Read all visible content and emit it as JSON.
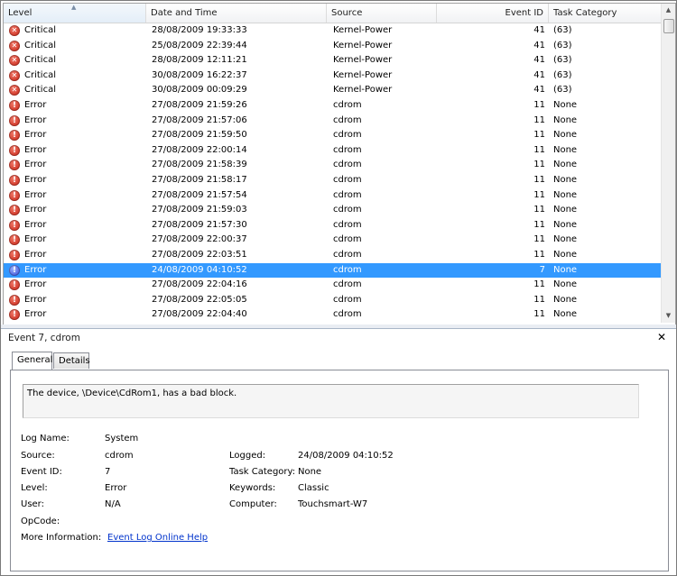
{
  "grid": {
    "columns": {
      "level": "Level",
      "date": "Date and Time",
      "source": "Source",
      "event_id": "Event ID",
      "category": "Task Category"
    },
    "rows": [
      {
        "level": "Critical",
        "icon": "critical-icon",
        "date": "28/08/2009 19:33:33",
        "source": "Kernel-Power",
        "id": "41",
        "category": "(63)"
      },
      {
        "level": "Critical",
        "icon": "critical-icon",
        "date": "25/08/2009 22:39:44",
        "source": "Kernel-Power",
        "id": "41",
        "category": "(63)"
      },
      {
        "level": "Critical",
        "icon": "critical-icon",
        "date": "28/08/2009 12:11:21",
        "source": "Kernel-Power",
        "id": "41",
        "category": "(63)"
      },
      {
        "level": "Critical",
        "icon": "critical-icon",
        "date": "30/08/2009 16:22:37",
        "source": "Kernel-Power",
        "id": "41",
        "category": "(63)"
      },
      {
        "level": "Critical",
        "icon": "critical-icon",
        "date": "30/08/2009 00:09:29",
        "source": "Kernel-Power",
        "id": "41",
        "category": "(63)"
      },
      {
        "level": "Error",
        "icon": "error-icon",
        "date": "27/08/2009 21:59:26",
        "source": "cdrom",
        "id": "11",
        "category": "None"
      },
      {
        "level": "Error",
        "icon": "error-icon",
        "date": "27/08/2009 21:57:06",
        "source": "cdrom",
        "id": "11",
        "category": "None"
      },
      {
        "level": "Error",
        "icon": "error-icon",
        "date": "27/08/2009 21:59:50",
        "source": "cdrom",
        "id": "11",
        "category": "None"
      },
      {
        "level": "Error",
        "icon": "error-icon",
        "date": "27/08/2009 22:00:14",
        "source": "cdrom",
        "id": "11",
        "category": "None"
      },
      {
        "level": "Error",
        "icon": "error-icon",
        "date": "27/08/2009 21:58:39",
        "source": "cdrom",
        "id": "11",
        "category": "None"
      },
      {
        "level": "Error",
        "icon": "error-icon",
        "date": "27/08/2009 21:58:17",
        "source": "cdrom",
        "id": "11",
        "category": "None"
      },
      {
        "level": "Error",
        "icon": "error-icon",
        "date": "27/08/2009 21:57:54",
        "source": "cdrom",
        "id": "11",
        "category": "None"
      },
      {
        "level": "Error",
        "icon": "error-icon",
        "date": "27/08/2009 21:59:03",
        "source": "cdrom",
        "id": "11",
        "category": "None"
      },
      {
        "level": "Error",
        "icon": "error-icon",
        "date": "27/08/2009 21:57:30",
        "source": "cdrom",
        "id": "11",
        "category": "None"
      },
      {
        "level": "Error",
        "icon": "error-icon",
        "date": "27/08/2009 22:00:37",
        "source": "cdrom",
        "id": "11",
        "category": "None"
      },
      {
        "level": "Error",
        "icon": "error-icon",
        "date": "27/08/2009 22:03:51",
        "source": "cdrom",
        "id": "11",
        "category": "None"
      },
      {
        "level": "Error",
        "icon": "error-icon",
        "date": "24/08/2009 04:10:52",
        "source": "cdrom",
        "id": "7",
        "category": "None",
        "selected": true
      },
      {
        "level": "Error",
        "icon": "error-icon",
        "date": "27/08/2009 22:04:16",
        "source": "cdrom",
        "id": "11",
        "category": "None"
      },
      {
        "level": "Error",
        "icon": "error-icon",
        "date": "27/08/2009 22:05:05",
        "source": "cdrom",
        "id": "11",
        "category": "None"
      },
      {
        "level": "Error",
        "icon": "error-icon",
        "date": "27/08/2009 22:04:40",
        "source": "cdrom",
        "id": "11",
        "category": "None"
      }
    ]
  },
  "details": {
    "title": "Event 7, cdrom",
    "close_glyph": "✕",
    "tabs": [
      "General",
      "Details"
    ],
    "description": "The device, \\Device\\CdRom1, has a bad block.",
    "labels": {
      "log_name": "Log Name:",
      "source": "Source:",
      "event_id": "Event ID:",
      "level": "Level:",
      "user": "User:",
      "opcode": "OpCode:",
      "more_info": "More Information:",
      "logged": "Logged:",
      "task_category": "Task Category:",
      "keywords": "Keywords:",
      "computer": "Computer:"
    },
    "values": {
      "log_name": "System",
      "source": "cdrom",
      "event_id": "7",
      "level": "Error",
      "user": "N/A",
      "opcode": "",
      "more_info_link": "Event Log Online Help",
      "logged": "24/08/2009 04:10:52",
      "task_category": "None",
      "keywords": "Classic",
      "computer": "Touchsmart-W7"
    }
  },
  "colors": {
    "selection": "#3399ff",
    "link": "#0033cc",
    "error_icon": "#c41a0c",
    "selected_icon": "#2c3fd0"
  }
}
